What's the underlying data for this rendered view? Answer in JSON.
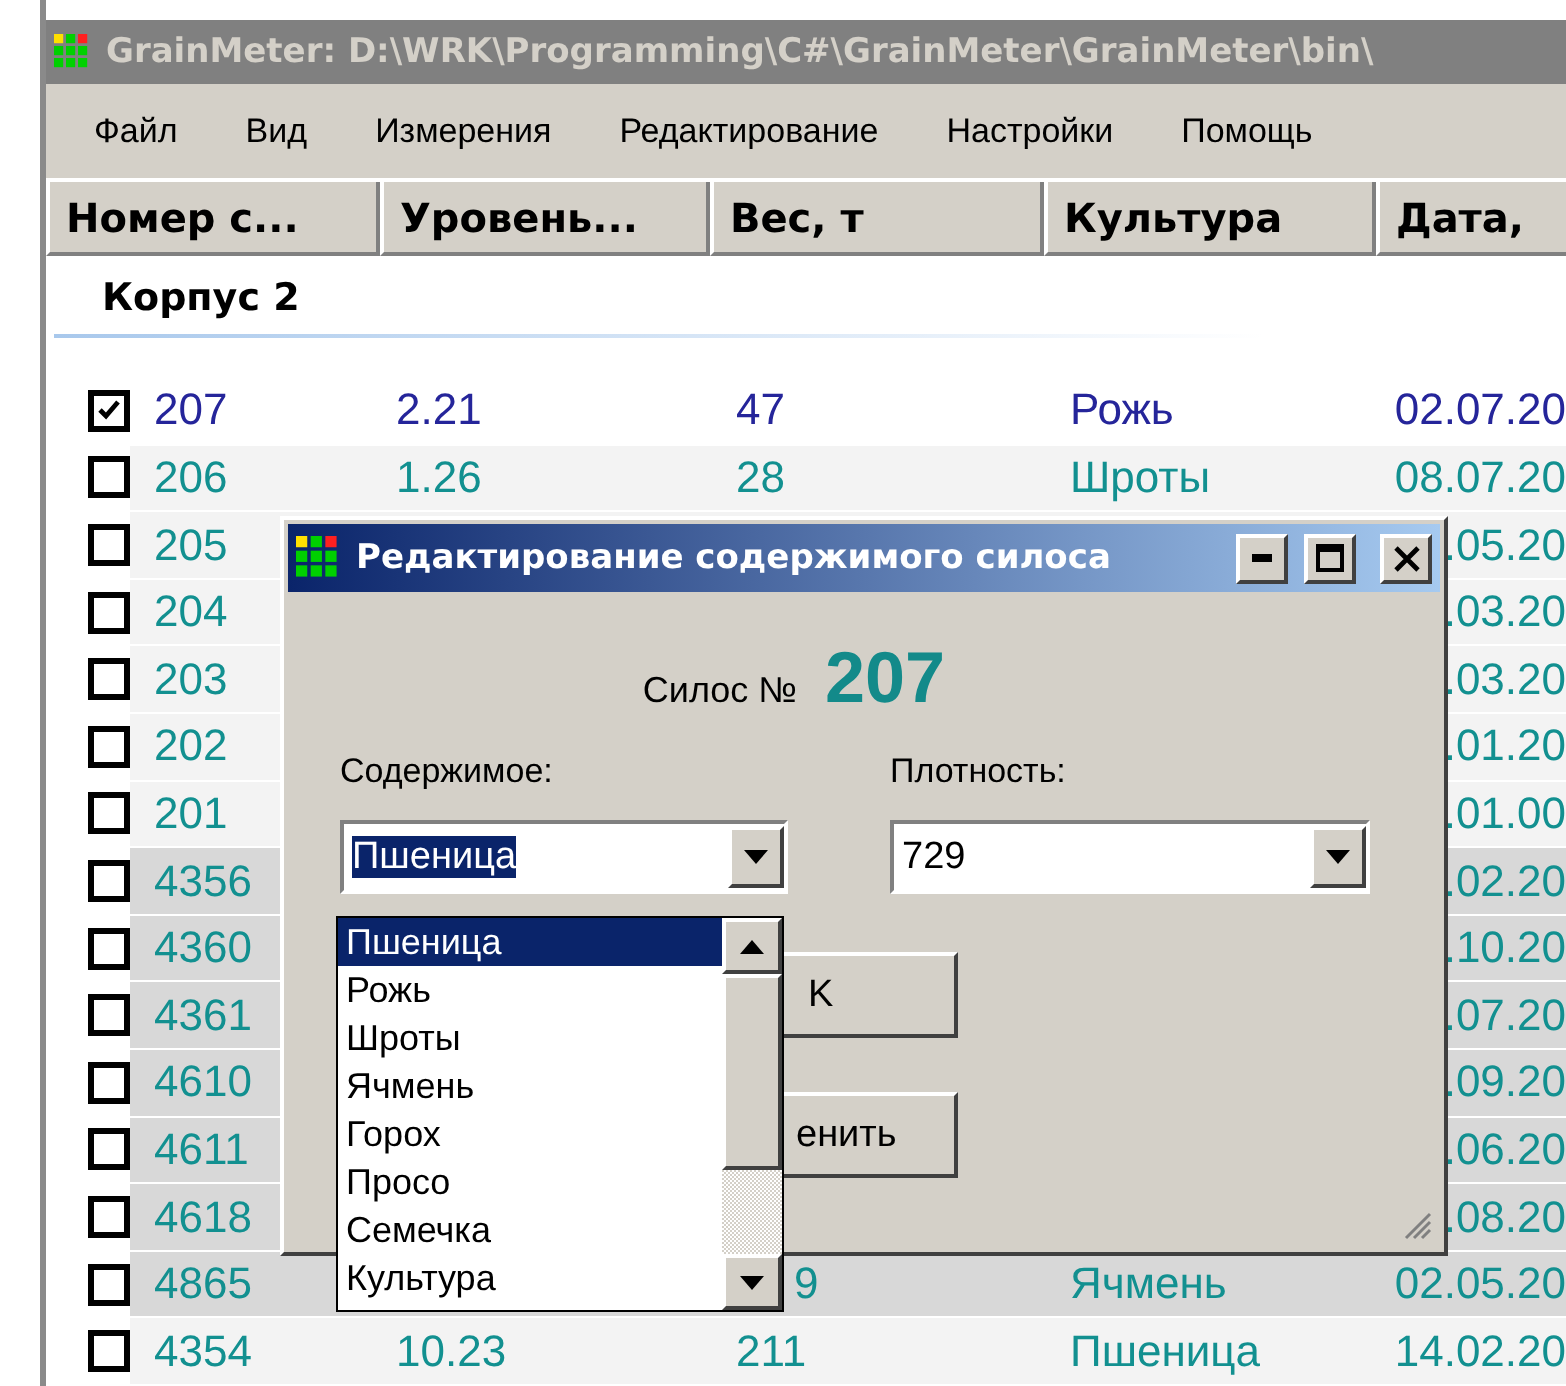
{
  "window": {
    "title": "GrainMeter: D:\\WRK\\Programming\\C#\\GrainMeter\\GrainMeter\\bin\\"
  },
  "menu": [
    "Файл",
    "Вид",
    "Измерения",
    "Редактирование",
    "Настройки",
    "Помощь"
  ],
  "table": {
    "columns": [
      "Номер с...",
      "Уровень...",
      "Вес, т",
      "Культура",
      "Дата,"
    ],
    "group": "Корпус 2",
    "rows": [
      {
        "number": "207",
        "level": "2.21",
        "weight": "47",
        "culture": "Рожь",
        "date": "02.07.20",
        "checked": true,
        "color": "#ffffff"
      },
      {
        "number": "206",
        "level": "1.26",
        "weight": "28",
        "culture": "Шроты",
        "date": "08.07.20",
        "checked": false,
        "color": "#f3f3f3"
      },
      {
        "number": "205",
        "date": ".05.20",
        "checked": false,
        "color": "#f3f3f3"
      },
      {
        "number": "204",
        "date": ".03.20",
        "checked": false,
        "color": "#f3f3f3"
      },
      {
        "number": "203",
        "date": ".03.20",
        "checked": false,
        "color": "#f3f3f3"
      },
      {
        "number": "202",
        "date": ".01.20",
        "checked": false,
        "color": "#f3f3f3"
      },
      {
        "number": "201",
        "date": ".01.00",
        "checked": false,
        "color": "#f3f3f3"
      },
      {
        "number": "4356",
        "date": ".02.20",
        "checked": false,
        "color": "#d8d8d8"
      },
      {
        "number": "4360",
        "date": ".10.20",
        "checked": false,
        "color": "#d8d8d8"
      },
      {
        "number": "4361",
        "date": ".07.20",
        "checked": false,
        "color": "#d8d8d8"
      },
      {
        "number": "4610",
        "date": ".09.20",
        "checked": false,
        "color": "#d8d8d8"
      },
      {
        "number": "4611",
        "date": ".06.20",
        "checked": false,
        "color": "#d8d8d8"
      },
      {
        "number": "4618",
        "date": ".08.20",
        "checked": false,
        "color": "#d8d8d8"
      },
      {
        "number": "4865",
        "weight": "9",
        "culture": "Ячмень",
        "date": "02.05.20",
        "checked": false,
        "color": "#d8d8d8"
      },
      {
        "number": "4354",
        "level": "10.23",
        "weight": "211",
        "culture": "Пшеница",
        "date": "14.02.20",
        "checked": false,
        "color": "#f3f3f3"
      }
    ]
  },
  "dialog": {
    "title": "Редактирование содержимого силоса",
    "silo_label": "Силос №",
    "silo_number": "207",
    "content_label": "Содержимое:",
    "content_value": "Пшеница",
    "density_label": "Плотность:",
    "density_value": "729",
    "buttons": [
      "K",
      "енить"
    ],
    "dropdown": [
      {
        "label": "Пшеница",
        "selected": true
      },
      {
        "label": "Рожь",
        "selected": false
      },
      {
        "label": "Шроты",
        "selected": false
      },
      {
        "label": "Ячмень",
        "selected": false
      },
      {
        "label": "Горох",
        "selected": false
      },
      {
        "label": "Просо",
        "selected": false
      },
      {
        "label": "Семечка",
        "selected": false
      },
      {
        "label": "Культура",
        "selected": false
      }
    ]
  }
}
